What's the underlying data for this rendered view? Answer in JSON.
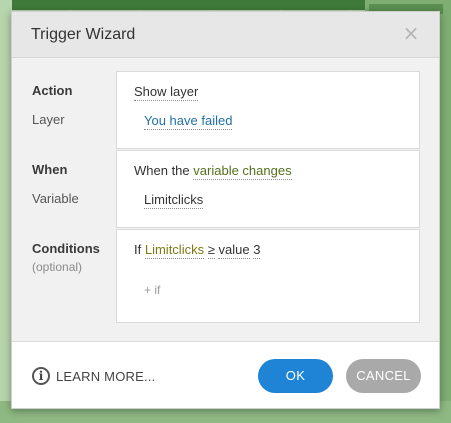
{
  "dialog": {
    "title": "Trigger Wizard",
    "close_glyph": "×"
  },
  "action": {
    "label": "Action",
    "layer_label": "Layer",
    "action_value": "Show layer",
    "layer_value": "You have failed"
  },
  "when": {
    "label": "When",
    "variable_label": "Variable",
    "prefix": "When the",
    "event_value": "variable changes",
    "variable_value": "Limitclicks"
  },
  "conditions": {
    "label": "Conditions",
    "optional_label": "(optional)",
    "if_prefix": "If",
    "variable": "Limitclicks",
    "operator": "≥",
    "value_word": "value",
    "value": "3",
    "add_if": "+ if"
  },
  "footer": {
    "learn_more": "LEARN MORE...",
    "info_glyph": "i",
    "ok_label": "OK",
    "cancel_label": "CANCEL"
  },
  "colors": {
    "ok_button": "#1f84d6",
    "cancel_button": "#a9a9a9",
    "link_blue": "#1f6fa8",
    "highlight_green": "#55701a",
    "highlight_olive": "#7c7a14"
  }
}
